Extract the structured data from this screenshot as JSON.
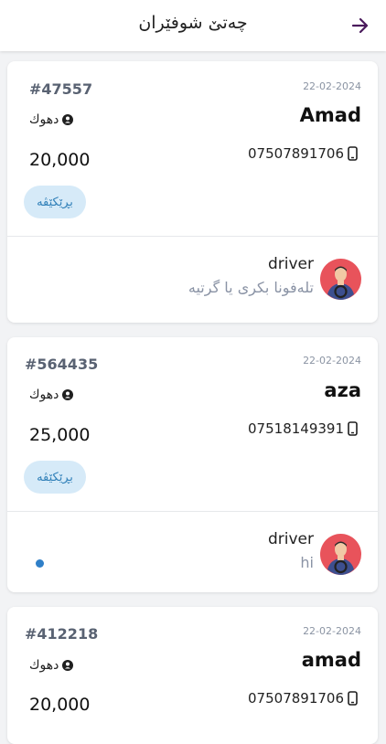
{
  "header": {
    "title": "چەتێ شوفێران",
    "back_icon": "arrow-right-icon"
  },
  "colors": {
    "accent": "#4a1a5c",
    "badge_bg": "#d6eaf8",
    "badge_text": "#2f7fb8",
    "unread_dot": "#2f7fc8"
  },
  "orders": [
    {
      "id": "#47557",
      "date": "22-02-2024",
      "customer": "Amad",
      "location": "دهوك",
      "phone": "07507891706",
      "price": "20,000",
      "status": "بڕێکێڤە",
      "chat": {
        "sender": "driver",
        "message": "تلەفونا بکری یا گرتیە",
        "unread": false
      }
    },
    {
      "id": "#564435",
      "date": "22-02-2024",
      "customer": "aza",
      "location": "دهوك",
      "phone": "07518149391",
      "price": "25,000",
      "status": "بڕێکێڤە",
      "chat": {
        "sender": "driver",
        "message": "hi",
        "unread": true
      }
    },
    {
      "id": "#412218",
      "date": "22-02-2024",
      "customer": "amad",
      "location": "دهوك",
      "phone": "07507891706",
      "price": "20,000",
      "status": "",
      "chat": null
    }
  ]
}
